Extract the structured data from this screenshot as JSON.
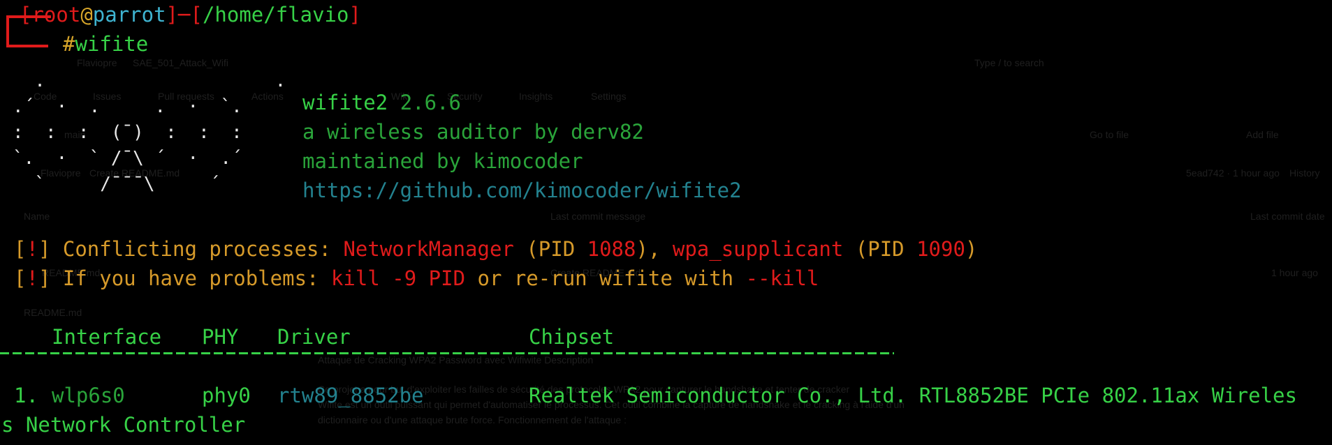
{
  "prompt": {
    "user": "root",
    "at": "@",
    "host": "parrot",
    "path": "/home/flavio",
    "symbol": "#",
    "command": "wifite"
  },
  "logo_lines": [
    "  .                     .  ",
    ".´  ·  .     .  ·  `.  ",
    ":  :  :  (¯)  :  :  :  ",
    "`.  ·  ` /¯\\ ´  ·  .´  ",
    "  `     /¯¯¯\\     ´    "
  ],
  "banner": {
    "name": "wifite2",
    "version": "2.6.6",
    "tagline": "a wireless auditor by derv82",
    "maintainer": "maintained by kimocoder",
    "url": "https://github.com/kimocoder/wifite2"
  },
  "warnings": {
    "w1_prefix": "Conflicting processes: ",
    "w1_proc1": "NetworkManager",
    "w1_pid_label1": " (PID ",
    "w1_pid1": "1088",
    "w1_sep": "), ",
    "w1_proc2": "wpa_supplicant",
    "w1_pid_label2": " (PID ",
    "w1_pid2": "1090",
    "w1_end": ")",
    "w2_prefix": "If you have problems: ",
    "w2_cmd1": "kill -9 PID",
    "w2_mid": " or re-run wifite with ",
    "w2_cmd2": "--kill",
    "bang": "!"
  },
  "table": {
    "headers": [
      "Interface",
      "PHY",
      "Driver",
      "Chipset"
    ],
    "rows": [
      {
        "num": "1.",
        "interface": "wlp6s0",
        "phy": "phy0",
        "driver": "rtw89_8852be",
        "chipset_line1": "Realtek Semiconductor Co., Ltd. RTL8852BE PCIe 802.11ax Wireles",
        "chipset_line2": "s Network Controller"
      }
    ]
  },
  "background_page": {
    "repo_owner": "Flaviopre",
    "repo_name": "SAE_501_Attack_Wifi",
    "search_placeholder": "Type / to search",
    "tabs": [
      "Code",
      "Issues",
      "Pull requests",
      "Actions",
      "Projects",
      "Wiki",
      "Security",
      "Insights",
      "Settings"
    ],
    "branch": "main",
    "file_search": "Go to file",
    "add_file": "Add file",
    "commit_author": "Flaviopre",
    "commit_msg": "Create README.md",
    "commit_meta": "5ead742 · 1 hour ago",
    "history": "History",
    "col_name": "Name",
    "col_msg": "Last commit message",
    "col_date": "Last commit date",
    "file1": "README.md",
    "file1_msg": "Create README.md",
    "file1_date": "1 hour ago",
    "readme_title": "README.md",
    "readme_h": "Attaque de Cracking WPA2 Password avec Wifiwite Description",
    "readme_p1": "Ce projet a pour but d'exploiter les failles de sécurité des protocoles WPA2 pour capturer le handshake et tenter de cracker",
    "readme_p2": "Wifite est un outil puissant qui permet d'automatiser le processus. Cet outil combine la capture de handshake et le cracking à l'aide d'un",
    "readme_p3": "dictionnaire ou d'une attaque brute force. Fonctionnement de l'attaque :"
  }
}
